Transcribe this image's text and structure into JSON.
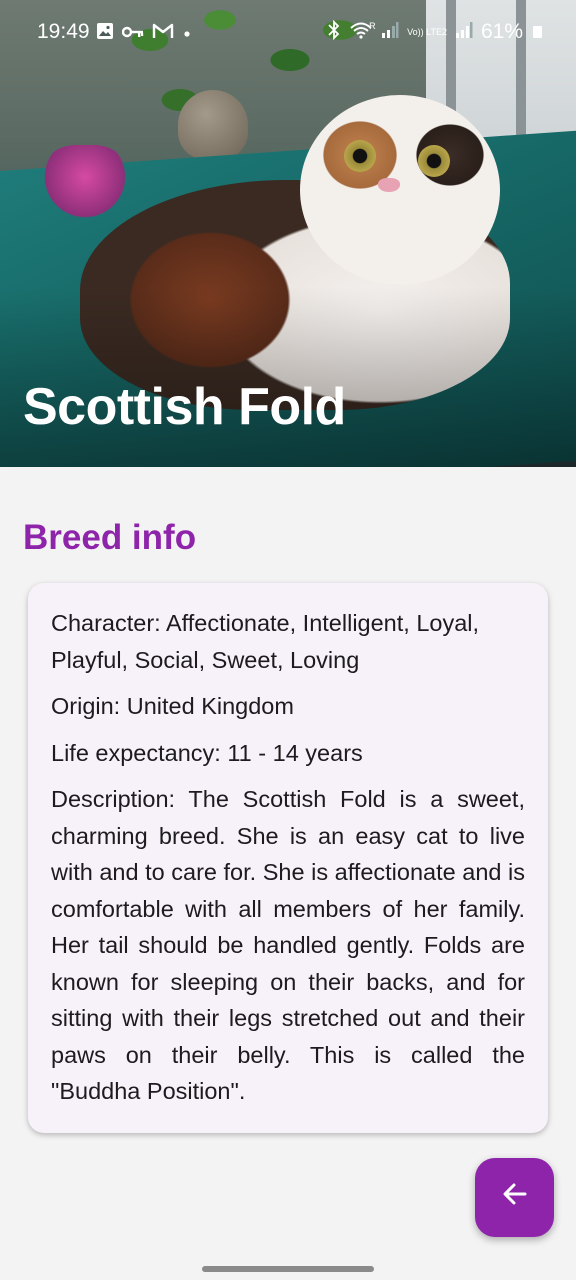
{
  "status_bar": {
    "time": "19:49",
    "battery": "61%",
    "left_icons": [
      "image-icon",
      "key-icon",
      "gmail-icon",
      "dot-icon"
    ],
    "right_icons": [
      "bluetooth-icon",
      "wifi-icon",
      "signal-icon",
      "volte-icon",
      "signal-icon"
    ],
    "volte_label": "Vo)) LTE2",
    "wifi_label": "R"
  },
  "header": {
    "title": "Scottish Fold"
  },
  "section": {
    "title": "Breed info"
  },
  "breed": {
    "character": "Character: Affectionate, Intelligent, Loyal, Playful, Social, Sweet, Loving",
    "origin": "Origin: United Kingdom",
    "life_expectancy": "Life expectancy: 11 - 14 years",
    "description": "Description: The Scottish Fold is a sweet, charming breed. She is an easy cat to live with and to care for. She is affectionate and is comfortable with all members of her family. Her tail should be handled gently. Folds are known for sleeping on their backs, and for sitting with their legs stretched out and their paws on their belly. This is called the \"Buddha Position\"."
  },
  "fab": {
    "icon": "arrow-left-icon"
  },
  "colors": {
    "accent": "#8e24aa",
    "card_bg": "#f7f2f9",
    "page_bg": "#f4f3f4"
  }
}
